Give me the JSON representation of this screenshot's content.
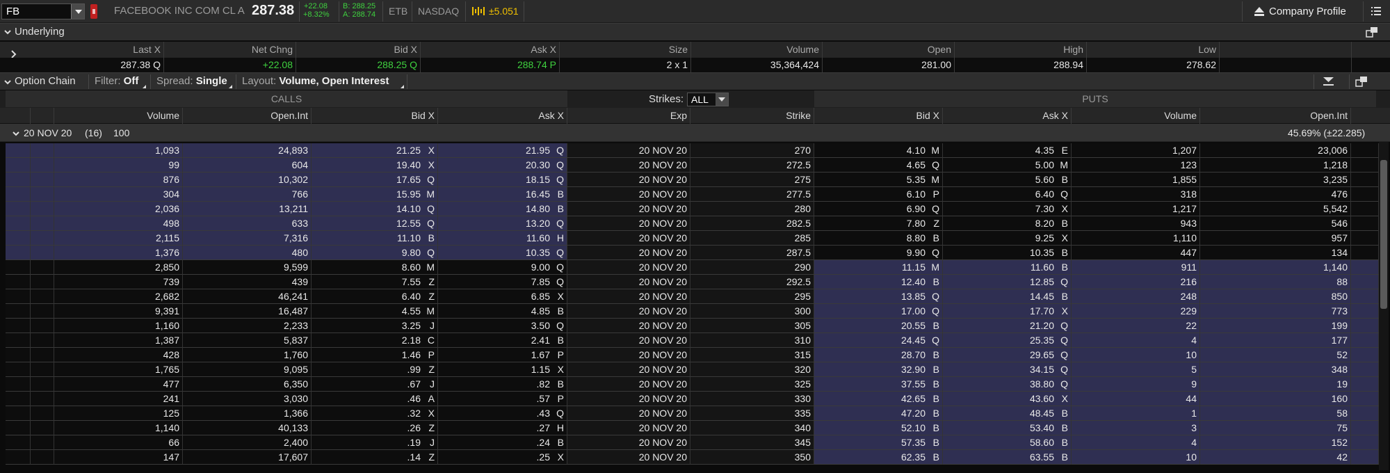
{
  "quote": {
    "symbol": "FB",
    "company": "FACEBOOK INC COM CL A",
    "last": "287.38",
    "net_change": "+22.08",
    "pct_change": "+8.32%",
    "bid": "B: 288.25",
    "ask": "A: 288.74",
    "etb": "ETB",
    "exchange": "NASDAQ",
    "market_maker_move": "±5.051",
    "company_profile_label": "Company Profile"
  },
  "underlying": {
    "title": "Underlying",
    "headers": [
      "Last X",
      "Net Chng",
      "Bid X",
      "Ask X",
      "Size",
      "Volume",
      "Open",
      "High",
      "Low"
    ],
    "values": {
      "last": "287.38 Q",
      "net_chng": "+22.08",
      "bid_x": "288.25 Q",
      "ask_x": "288.74 P",
      "size": "2 x 1",
      "volume": "35,364,424",
      "open": "281.00",
      "high": "288.94",
      "low": "278.62"
    }
  },
  "option_chain": {
    "title": "Option Chain",
    "filter_label": "Filter:",
    "filter_value": "Off",
    "spread_label": "Spread:",
    "spread_value": "Single",
    "layout_label": "Layout:",
    "layout_value": "Volume, Open Interest",
    "calls_label": "CALLS",
    "puts_label": "PUTS",
    "strikes_label": "Strikes:",
    "strikes_value": "ALL",
    "call_headers": [
      "Volume",
      "Open.Int",
      "Bid X",
      "Ask X"
    ],
    "exp_header": "Exp",
    "strike_header": "Strike",
    "put_headers": [
      "Bid X",
      "Ask X",
      "Volume",
      "Open.Int"
    ],
    "series": {
      "expiry": "20 NOV 20",
      "count": "(16)",
      "multiplier": "100",
      "iv": "45.69% (±22.285)"
    },
    "rows": [
      {
        "cv": "1,093",
        "coi": "24,893",
        "cb": "21.25",
        "cbx": "X",
        "ca": "21.95",
        "cax": "Q",
        "exp": "20 NOV 20",
        "k": "270",
        "pb": "4.10",
        "pbx": "M",
        "pa": "4.35",
        "pax": "E",
        "pv": "1,207",
        "poi": "23,006"
      },
      {
        "cv": "99",
        "coi": "604",
        "cb": "19.40",
        "cbx": "X",
        "ca": "20.30",
        "cax": "Q",
        "exp": "20 NOV 20",
        "k": "272.5",
        "pb": "4.65",
        "pbx": "Q",
        "pa": "5.00",
        "pax": "M",
        "pv": "123",
        "poi": "1,218"
      },
      {
        "cv": "876",
        "coi": "10,302",
        "cb": "17.65",
        "cbx": "Q",
        "ca": "18.15",
        "cax": "Q",
        "exp": "20 NOV 20",
        "k": "275",
        "pb": "5.35",
        "pbx": "M",
        "pa": "5.60",
        "pax": "B",
        "pv": "1,855",
        "poi": "3,235"
      },
      {
        "cv": "304",
        "coi": "766",
        "cb": "15.95",
        "cbx": "M",
        "ca": "16.45",
        "cax": "B",
        "exp": "20 NOV 20",
        "k": "277.5",
        "pb": "6.10",
        "pbx": "P",
        "pa": "6.40",
        "pax": "Q",
        "pv": "318",
        "poi": "476"
      },
      {
        "cv": "2,036",
        "coi": "13,211",
        "cb": "14.10",
        "cbx": "Q",
        "ca": "14.80",
        "cax": "B",
        "exp": "20 NOV 20",
        "k": "280",
        "pb": "6.90",
        "pbx": "Q",
        "pa": "7.30",
        "pax": "X",
        "pv": "1,217",
        "poi": "5,542"
      },
      {
        "cv": "498",
        "coi": "633",
        "cb": "12.55",
        "cbx": "Q",
        "ca": "13.20",
        "cax": "Q",
        "exp": "20 NOV 20",
        "k": "282.5",
        "pb": "7.80",
        "pbx": "Z",
        "pa": "8.20",
        "pax": "B",
        "pv": "943",
        "poi": "546"
      },
      {
        "cv": "2,115",
        "coi": "7,316",
        "cb": "11.10",
        "cbx": "B",
        "ca": "11.60",
        "cax": "H",
        "exp": "20 NOV 20",
        "k": "285",
        "pb": "8.80",
        "pbx": "B",
        "pa": "9.25",
        "pax": "X",
        "pv": "1,110",
        "poi": "957"
      },
      {
        "cv": "1,376",
        "coi": "480",
        "cb": "9.80",
        "cbx": "Q",
        "ca": "10.35",
        "cax": "Q",
        "exp": "20 NOV 20",
        "k": "287.5",
        "pb": "9.90",
        "pbx": "Q",
        "pa": "10.35",
        "pax": "B",
        "pv": "447",
        "poi": "134"
      },
      {
        "cv": "2,850",
        "coi": "9,599",
        "cb": "8.60",
        "cbx": "M",
        "ca": "9.00",
        "cax": "Q",
        "exp": "20 NOV 20",
        "k": "290",
        "pb": "11.15",
        "pbx": "M",
        "pa": "11.60",
        "pax": "B",
        "pv": "911",
        "poi": "1,140"
      },
      {
        "cv": "739",
        "coi": "439",
        "cb": "7.55",
        "cbx": "Z",
        "ca": "7.85",
        "cax": "Q",
        "exp": "20 NOV 20",
        "k": "292.5",
        "pb": "12.40",
        "pbx": "B",
        "pa": "12.85",
        "pax": "Q",
        "pv": "216",
        "poi": "88"
      },
      {
        "cv": "2,682",
        "coi": "46,241",
        "cb": "6.40",
        "cbx": "Z",
        "ca": "6.85",
        "cax": "X",
        "exp": "20 NOV 20",
        "k": "295",
        "pb": "13.85",
        "pbx": "Q",
        "pa": "14.45",
        "pax": "B",
        "pv": "248",
        "poi": "850"
      },
      {
        "cv": "9,391",
        "coi": "16,487",
        "cb": "4.55",
        "cbx": "M",
        "ca": "4.85",
        "cax": "B",
        "exp": "20 NOV 20",
        "k": "300",
        "pb": "17.00",
        "pbx": "Q",
        "pa": "17.70",
        "pax": "X",
        "pv": "229",
        "poi": "773"
      },
      {
        "cv": "1,160",
        "coi": "2,233",
        "cb": "3.25",
        "cbx": "J",
        "ca": "3.50",
        "cax": "Q",
        "exp": "20 NOV 20",
        "k": "305",
        "pb": "20.55",
        "pbx": "B",
        "pa": "21.20",
        "pax": "Q",
        "pv": "22",
        "poi": "199"
      },
      {
        "cv": "1,387",
        "coi": "5,837",
        "cb": "2.18",
        "cbx": "C",
        "ca": "2.41",
        "cax": "B",
        "exp": "20 NOV 20",
        "k": "310",
        "pb": "24.45",
        "pbx": "Q",
        "pa": "25.35",
        "pax": "Q",
        "pv": "4",
        "poi": "177"
      },
      {
        "cv": "428",
        "coi": "1,760",
        "cb": "1.46",
        "cbx": "P",
        "ca": "1.67",
        "cax": "P",
        "exp": "20 NOV 20",
        "k": "315",
        "pb": "28.70",
        "pbx": "B",
        "pa": "29.65",
        "pax": "Q",
        "pv": "10",
        "poi": "52"
      },
      {
        "cv": "1,765",
        "coi": "9,095",
        "cb": ".99",
        "cbx": "Z",
        "ca": "1.15",
        "cax": "X",
        "exp": "20 NOV 20",
        "k": "320",
        "pb": "32.90",
        "pbx": "B",
        "pa": "34.15",
        "pax": "Q",
        "pv": "5",
        "poi": "348"
      },
      {
        "cv": "477",
        "coi": "6,350",
        "cb": ".67",
        "cbx": "J",
        "ca": ".82",
        "cax": "B",
        "exp": "20 NOV 20",
        "k": "325",
        "pb": "37.55",
        "pbx": "B",
        "pa": "38.80",
        "pax": "Q",
        "pv": "9",
        "poi": "19"
      },
      {
        "cv": "241",
        "coi": "3,030",
        "cb": ".46",
        "cbx": "A",
        "ca": ".57",
        "cax": "P",
        "exp": "20 NOV 20",
        "k": "330",
        "pb": "42.65",
        "pbx": "B",
        "pa": "43.60",
        "pax": "X",
        "pv": "44",
        "poi": "160"
      },
      {
        "cv": "125",
        "coi": "1,366",
        "cb": ".32",
        "cbx": "X",
        "ca": ".43",
        "cax": "Q",
        "exp": "20 NOV 20",
        "k": "335",
        "pb": "47.20",
        "pbx": "B",
        "pa": "48.45",
        "pax": "B",
        "pv": "1",
        "poi": "58"
      },
      {
        "cv": "1,140",
        "coi": "40,133",
        "cb": ".26",
        "cbx": "Z",
        "ca": ".27",
        "cax": "H",
        "exp": "20 NOV 20",
        "k": "340",
        "pb": "52.10",
        "pbx": "B",
        "pa": "53.40",
        "pax": "B",
        "pv": "3",
        "poi": "75"
      },
      {
        "cv": "66",
        "coi": "2,400",
        "cb": ".19",
        "cbx": "J",
        "ca": ".24",
        "cax": "B",
        "exp": "20 NOV 20",
        "k": "345",
        "pb": "57.35",
        "pbx": "B",
        "pa": "58.60",
        "pax": "B",
        "pv": "4",
        "poi": "152"
      },
      {
        "cv": "147",
        "coi": "17,607",
        "cb": ".14",
        "cbx": "Z",
        "ca": ".25",
        "cax": "X",
        "exp": "20 NOV 20",
        "k": "350",
        "pb": "62.35",
        "pbx": "B",
        "pa": "63.55",
        "pax": "B",
        "pv": "10",
        "poi": "42"
      }
    ],
    "itm_call_count": 8
  },
  "colors": {
    "itm_background": "#2f2f52",
    "positive": "#3fd13f",
    "mm_accent": "#f0c000",
    "alert": "#c02020"
  }
}
